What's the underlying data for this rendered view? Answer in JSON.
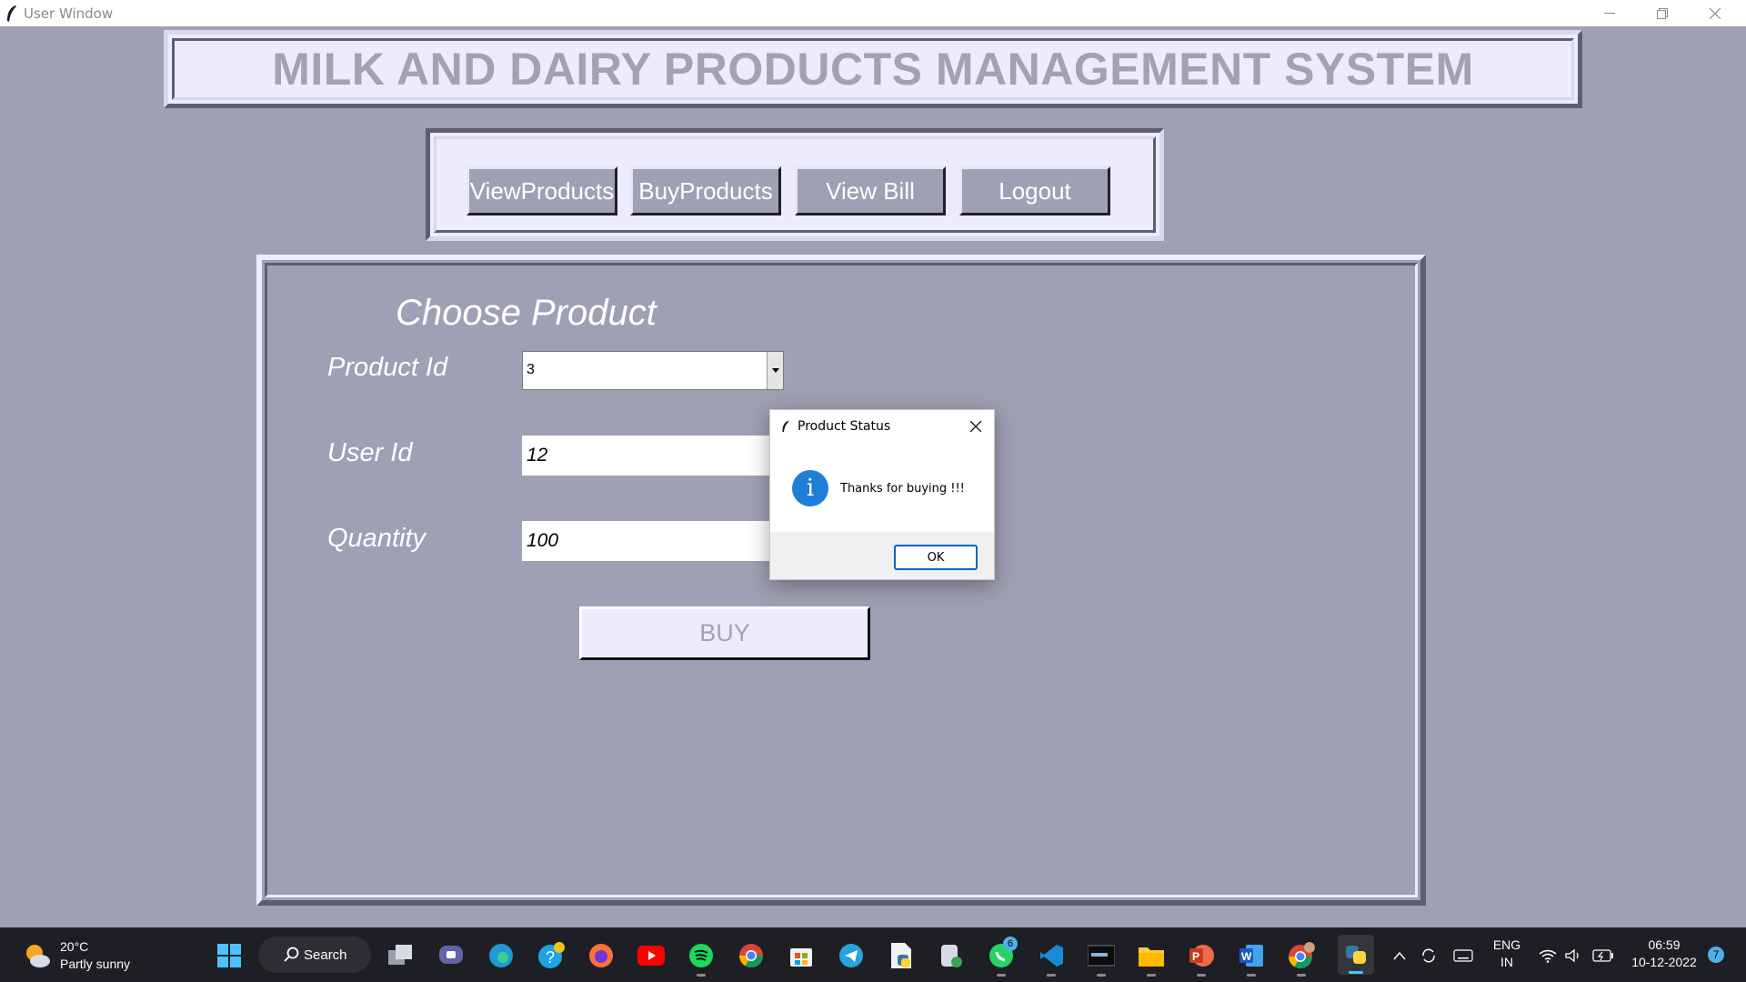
{
  "window": {
    "title": "User Window"
  },
  "app": {
    "header_title": "MILK AND DAIRY PRODUCTS MANAGEMENT SYSTEM",
    "nav": [
      {
        "label": "ViewProducts"
      },
      {
        "label": "BuyProducts"
      },
      {
        "label": "View Bill"
      },
      {
        "label": "Logout"
      }
    ],
    "form": {
      "section_title": "Choose Product",
      "product_id_label": "Product Id",
      "product_id_value": "3",
      "user_id_label": "User Id",
      "user_id_value": "12",
      "quantity_label": "Quantity",
      "quantity_value": "100",
      "buy_label": "BUY"
    }
  },
  "dialog": {
    "title": "Product Status",
    "message": "Thanks for buying !!!",
    "ok_label": "OK",
    "icon": "info-icon"
  },
  "taskbar": {
    "weather_temp": "20°C",
    "weather_desc": "Partly sunny",
    "search_label": "Search",
    "whatsapp_badge": "6",
    "lang_top": "ENG",
    "lang_bottom": "IN",
    "time": "06:59",
    "date": "10-12-2022",
    "notification_count": "7"
  },
  "colors": {
    "background": "#a0a0b4",
    "panel": "#ececfc",
    "taskbar": "#1e1f24",
    "accent": "#0067c0"
  }
}
